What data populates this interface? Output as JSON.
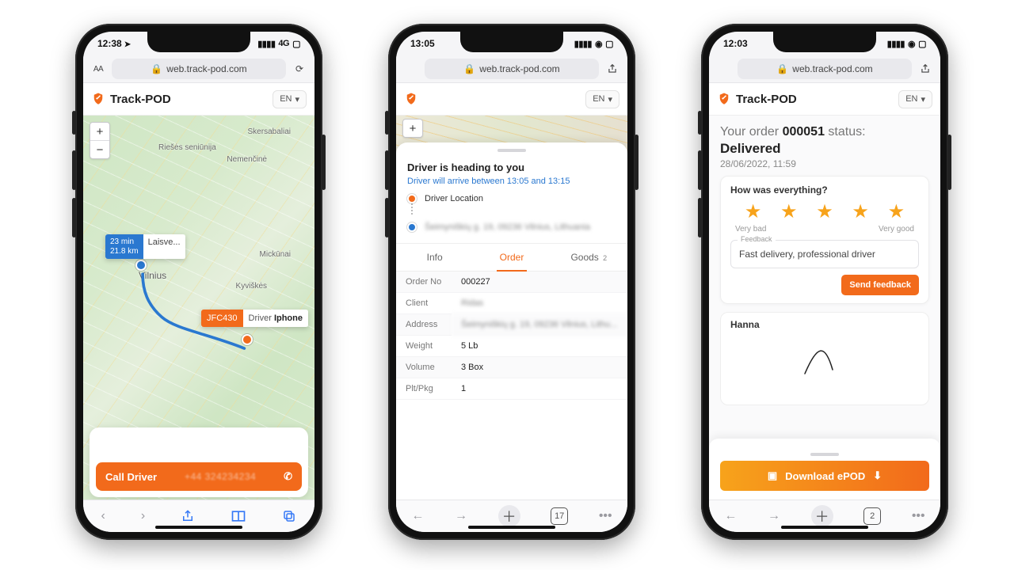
{
  "brand": {
    "name": "Track-POD",
    "lang": "EN"
  },
  "url": "web.track-pod.com",
  "phone1": {
    "time": "12:38",
    "network_label": "4G",
    "addr_left_label": "AA",
    "zoom_in": "+",
    "zoom_out": "−",
    "eta_line1": "23 min",
    "eta_line2": "21.8 km",
    "eta_place": "Laisve...",
    "city_label": "Vilnius",
    "labels": {
      "a": "Nemenčinė",
      "b": "Mickūnai",
      "c": "Kyviškės",
      "d": "Skersabaliai",
      "e": "Riešės seniūnija"
    },
    "driver_code": "JFC430",
    "driver_label": "Driver",
    "driver_name": "Iphone",
    "call_label": "Call Driver",
    "call_number": "+44 324234234"
  },
  "phone2": {
    "time": "13:05",
    "heading_title": "Driver is heading to you",
    "eta_text": "Driver will arrive between 13:05 and 13:15",
    "driver_loc_label": "Driver Location",
    "dest_addr": "Šeimyniškių g. 19, 09236 Vilnius, Lithuania",
    "tabs": {
      "info": "Info",
      "order": "Order",
      "goods": "Goods",
      "goods_count": "2"
    },
    "rows": {
      "order_no_k": "Order No",
      "order_no_v": "000227",
      "client_k": "Client",
      "client_v": "Ridas",
      "address_k": "Address",
      "address_v": "Šeimyniškių g. 19, 09236 Vilnius, Lithu...",
      "weight_k": "Weight",
      "weight_v": "5 Lb",
      "volume_k": "Volume",
      "volume_v": "3 Box",
      "plt_k": "Plt/Pkg",
      "plt_v": "1"
    },
    "tab_count": "17"
  },
  "phone3": {
    "time": "12:03",
    "status_prefix": "Your order",
    "order_no": "000051",
    "status_word": "status:",
    "status_value": "Delivered",
    "date": "28/06/2022, 11:59",
    "question": "How was everything?",
    "label_bad": "Very bad",
    "label_good": "Very good",
    "feedback_legend": "Feedback",
    "feedback_text": "Fast delivery, professional driver",
    "send": "Send feedback",
    "signer": "Hanna",
    "download": "Download ePOD",
    "tab_count": "2"
  }
}
